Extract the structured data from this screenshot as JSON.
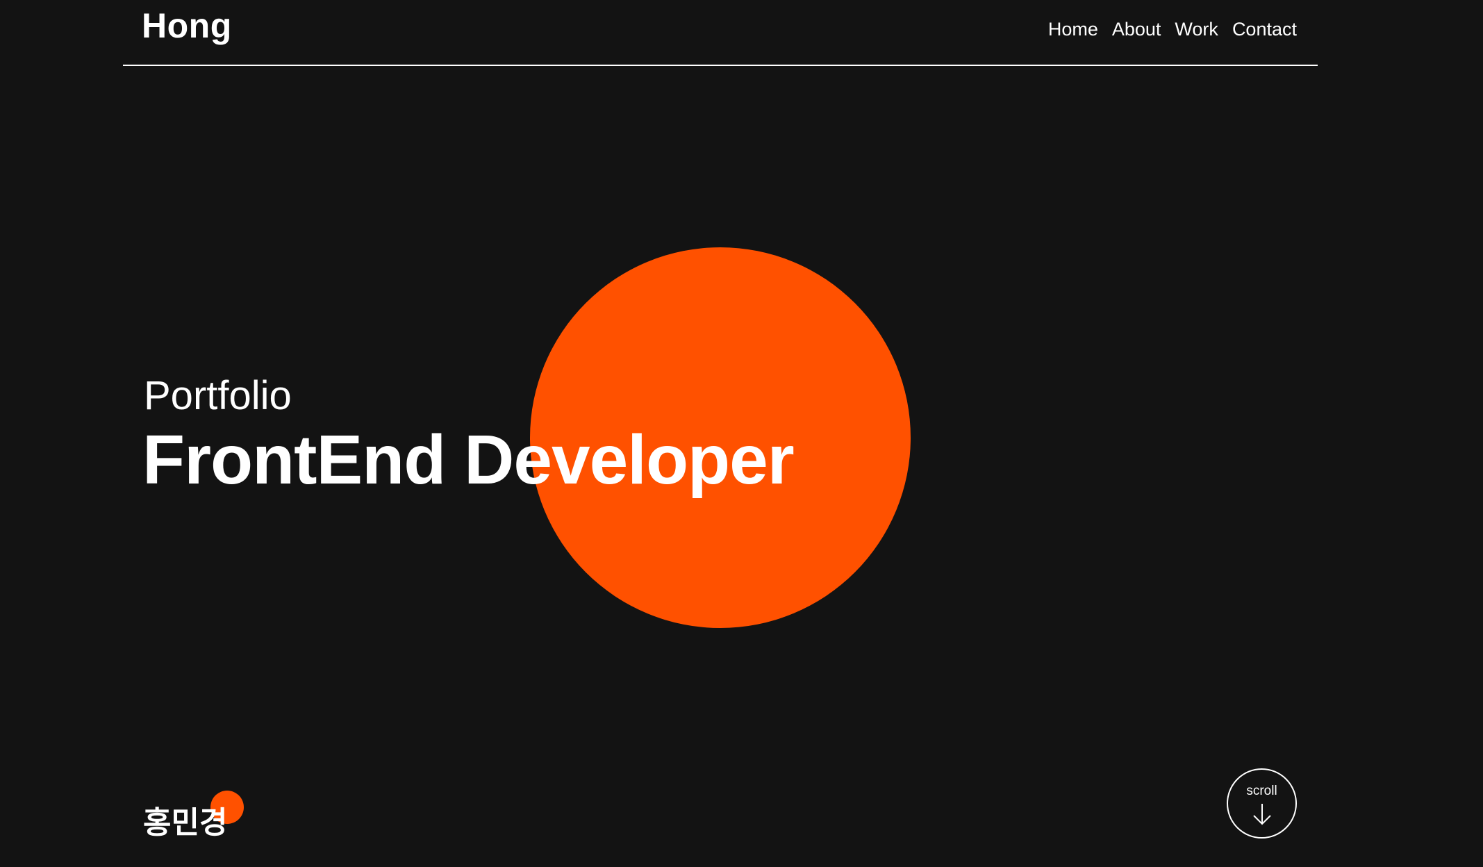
{
  "header": {
    "logo": "Hong",
    "nav": [
      {
        "label": "Home"
      },
      {
        "label": "About"
      },
      {
        "label": "Work"
      },
      {
        "label": "Contact"
      }
    ]
  },
  "hero": {
    "subtitle": "Portfolio",
    "title": "FrontEnd Developer"
  },
  "signature": {
    "name": "홍민경"
  },
  "scroll": {
    "label": "scroll",
    "icon": "arrow-down-icon"
  },
  "colors": {
    "background": "#131313",
    "accent": "#ff5100",
    "text": "#ffffff"
  }
}
